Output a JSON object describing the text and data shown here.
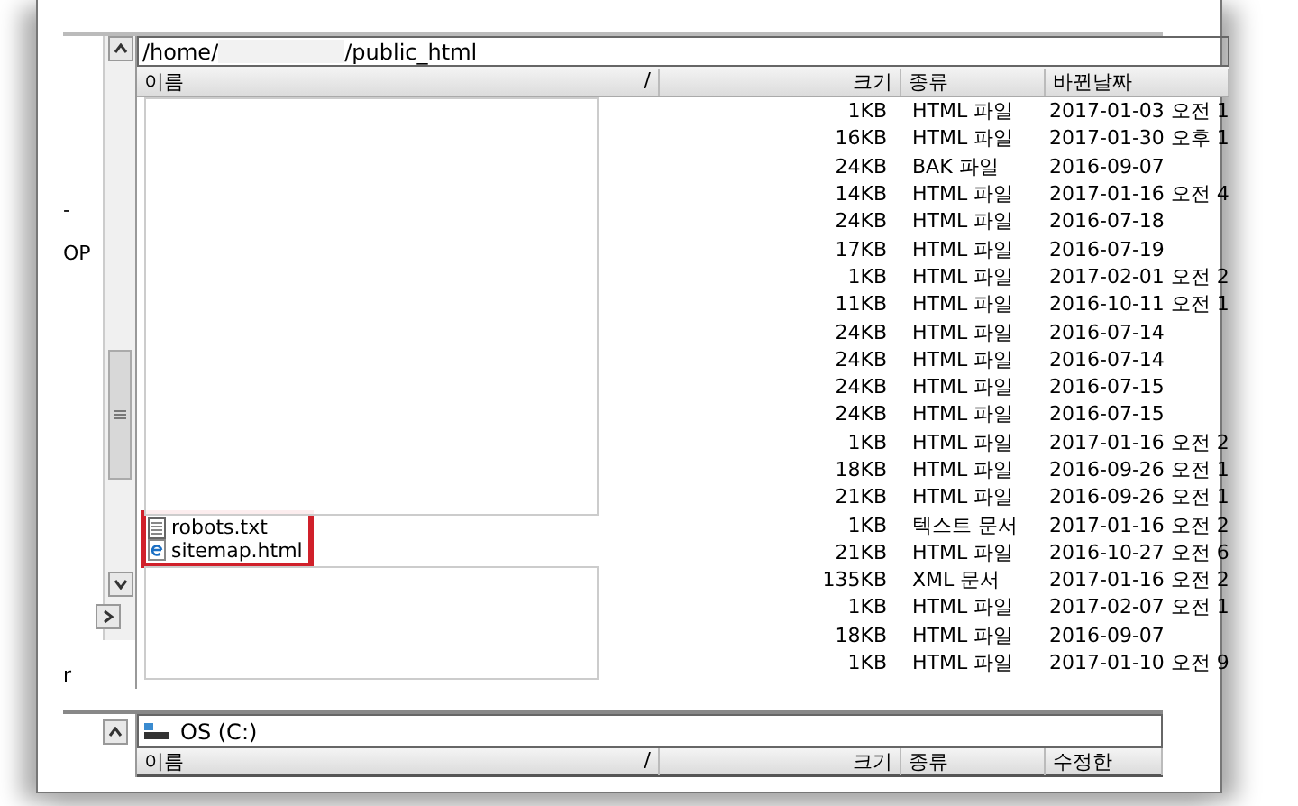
{
  "left_panel": {
    "labels": [
      "-",
      "OP",
      "r"
    ]
  },
  "remote_pane": {
    "path_start": "/home/",
    "path_end": "/public_html",
    "columns": [
      {
        "label": "이름",
        "sort": "/"
      },
      {
        "label": "크기"
      },
      {
        "label": "종류"
      },
      {
        "label": "바뀐날짜"
      }
    ],
    "rows": [
      {
        "name": "",
        "kind": "hidden",
        "size": "1KB",
        "type": "HTML 파일",
        "modified": "2017-01-03 오전 1",
        "highlighted": false
      },
      {
        "name": "",
        "kind": "hidden",
        "size": "16KB",
        "type": "HTML 파일",
        "modified": "2017-01-30 오후 1",
        "highlighted": false
      },
      {
        "name": "",
        "kind": "hidden",
        "size": "24KB",
        "type": "BAK 파일",
        "modified": "2016-09-07",
        "highlighted": false
      },
      {
        "name": "",
        "kind": "hidden",
        "size": "14KB",
        "type": "HTML 파일",
        "modified": "2017-01-16 오전 4",
        "highlighted": false
      },
      {
        "name": "",
        "kind": "hidden",
        "size": "24KB",
        "type": "HTML 파일",
        "modified": "2016-07-18",
        "highlighted": false
      },
      {
        "name": "",
        "kind": "hidden",
        "size": "17KB",
        "type": "HTML 파일",
        "modified": "2016-07-19",
        "highlighted": false
      },
      {
        "name": "",
        "kind": "hidden",
        "size": "1KB",
        "type": "HTML 파일",
        "modified": "2017-02-01 오전 2",
        "highlighted": false
      },
      {
        "name": "",
        "kind": "hidden",
        "size": "11KB",
        "type": "HTML 파일",
        "modified": "2016-10-11 오전 1",
        "highlighted": false
      },
      {
        "name": "",
        "kind": "hidden",
        "size": "24KB",
        "type": "HTML 파일",
        "modified": "2016-07-14",
        "highlighted": false
      },
      {
        "name": "",
        "kind": "hidden",
        "size": "24KB",
        "type": "HTML 파일",
        "modified": "2016-07-14",
        "highlighted": false
      },
      {
        "name": "",
        "kind": "hidden",
        "size": "24KB",
        "type": "HTML 파일",
        "modified": "2016-07-15",
        "highlighted": false
      },
      {
        "name": "",
        "kind": "hidden",
        "size": "24KB",
        "type": "HTML 파일",
        "modified": "2016-07-15",
        "highlighted": false
      },
      {
        "name": "",
        "kind": "hidden",
        "size": "1KB",
        "type": "HTML 파일",
        "modified": "2017-01-16 오전 2",
        "highlighted": false
      },
      {
        "name": "",
        "kind": "hidden",
        "size": "18KB",
        "type": "HTML 파일",
        "modified": "2016-09-26 오전 1",
        "highlighted": false
      },
      {
        "name": "",
        "kind": "hidden",
        "size": "21KB",
        "type": "HTML 파일",
        "modified": "2016-09-26 오전 1",
        "highlighted": false
      },
      {
        "name": "robots.txt",
        "kind": "text",
        "size": "1KB",
        "type": "텍스트 문서",
        "modified": "2017-01-16 오전 2",
        "highlighted": true
      },
      {
        "name": "sitemap.html",
        "kind": "html",
        "size": "21KB",
        "type": "HTML 파일",
        "modified": "2016-10-27 오전 6",
        "highlighted": true
      },
      {
        "name": "",
        "kind": "hidden",
        "size": "135KB",
        "type": "XML 문서",
        "modified": "2017-01-16 오전 2",
        "highlighted": false
      },
      {
        "name": "",
        "kind": "hidden",
        "size": "1KB",
        "type": "HTML 파일",
        "modified": "2017-02-07 오전 1",
        "highlighted": false
      },
      {
        "name": "",
        "kind": "hidden",
        "size": "18KB",
        "type": "HTML 파일",
        "modified": "2016-09-07",
        "highlighted": false
      },
      {
        "name": "",
        "kind": "hidden",
        "size": "1KB",
        "type": "HTML 파일",
        "modified": "2017-01-10 오전 9",
        "highlighted": false
      }
    ]
  },
  "local_pane": {
    "drive": "OS (C:)",
    "columns": [
      {
        "label": "이름",
        "sort": "/"
      },
      {
        "label": "크기"
      },
      {
        "label": "종류"
      },
      {
        "label": "수정한"
      }
    ]
  }
}
